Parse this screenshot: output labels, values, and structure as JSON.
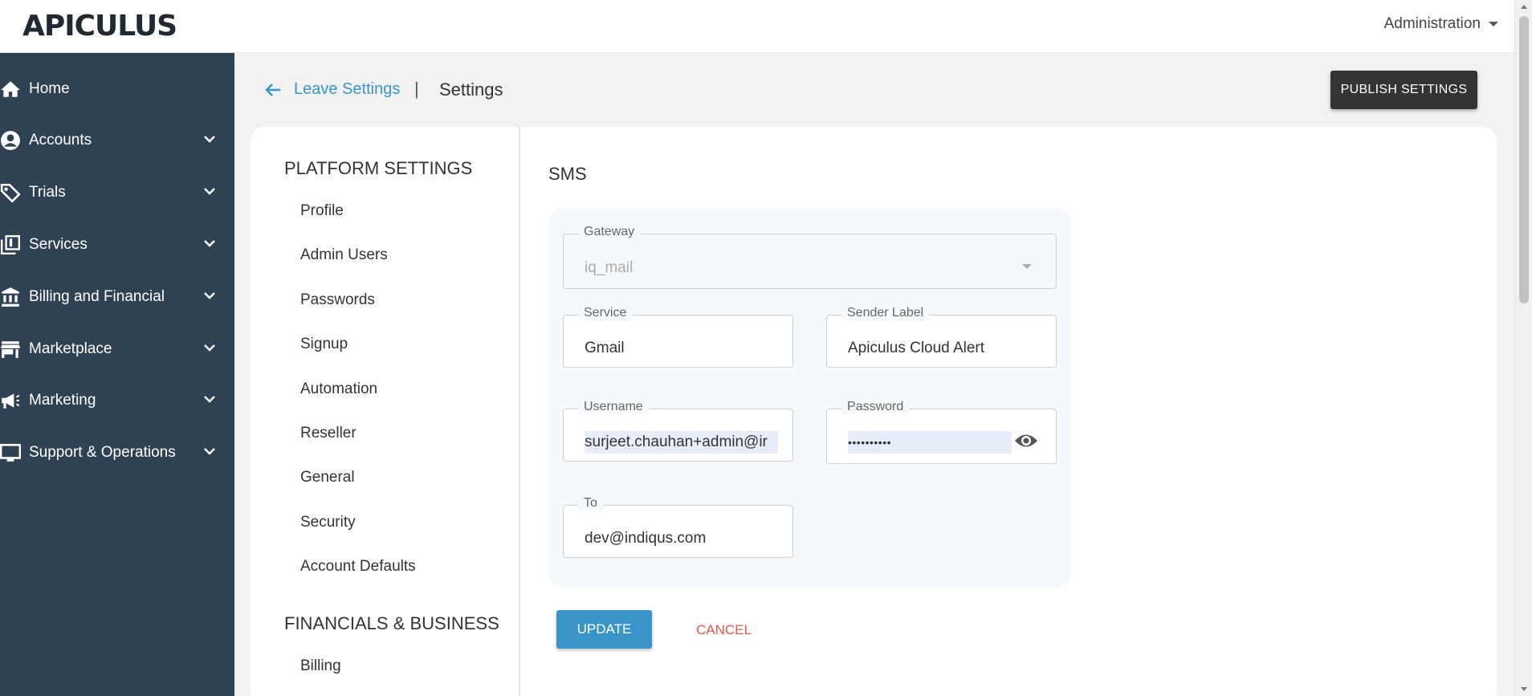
{
  "app": {
    "logo": "APICULUS"
  },
  "topbar": {
    "admin_menu": "Administration"
  },
  "sidebar": {
    "items": [
      {
        "label": "Home",
        "icon": "home-icon",
        "expandable": false
      },
      {
        "label": "Accounts",
        "icon": "user-icon",
        "expandable": true
      },
      {
        "label": "Trials",
        "icon": "tag-icon",
        "expandable": true
      },
      {
        "label": "Services",
        "icon": "library-icon",
        "expandable": true
      },
      {
        "label": "Billing and Financial",
        "icon": "bank-icon",
        "expandable": true
      },
      {
        "label": "Marketplace",
        "icon": "store-icon",
        "expandable": true
      },
      {
        "label": "Marketing",
        "icon": "megaphone-icon",
        "expandable": true
      },
      {
        "label": "Support & Operations",
        "icon": "monitor-icon",
        "expandable": true
      }
    ]
  },
  "header": {
    "back_link": "Leave Settings",
    "separator": "|",
    "title": "Settings",
    "publish_button": "PUBLISH SETTINGS"
  },
  "settings_menu": {
    "platform_heading": "PLATFORM SETTINGS",
    "platform_items": [
      "Profile",
      "Admin Users",
      "Passwords",
      "Signup",
      "Automation",
      "Reseller",
      "General",
      "Security",
      "Account Defaults"
    ],
    "financial_heading": "FINANCIALS & BUSINESS",
    "financial_items": [
      "Billing"
    ]
  },
  "sms": {
    "title": "SMS",
    "gateway": {
      "label": "Gateway",
      "value": "iq_mail"
    },
    "service": {
      "label": "Service",
      "value": "Gmail"
    },
    "sender_label": {
      "label": "Sender Label",
      "value": "Apiculus Cloud Alert"
    },
    "username": {
      "label": "Username",
      "value": "surjeet.chauhan+admin@ir"
    },
    "password": {
      "label": "Password",
      "value": "••••••••••"
    },
    "to": {
      "label": "To",
      "value": "dev@indiqus.com"
    },
    "update_button": "UPDATE",
    "cancel_button": "CANCEL"
  },
  "colors": {
    "sidebar_bg": "#2f4253",
    "accent": "#3a94c8",
    "publish_bg": "#343434",
    "cancel": "#e05a4b"
  }
}
